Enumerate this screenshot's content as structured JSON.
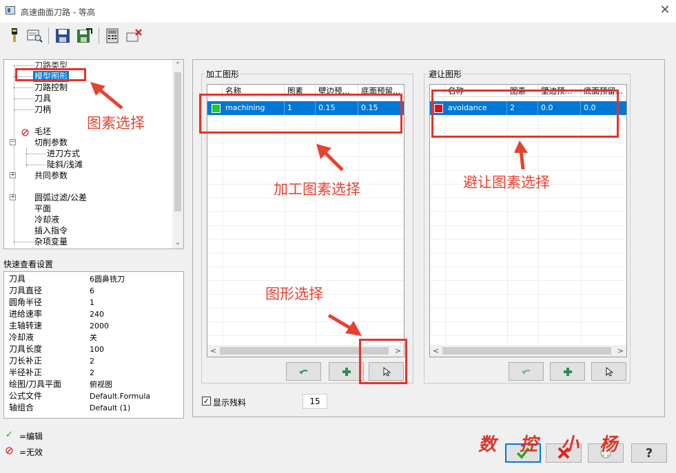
{
  "window": {
    "title": "高速曲面刀路 - 等高",
    "close": "✕"
  },
  "toolbar": {
    "icons": [
      "tool-icon",
      "preview-icon",
      "save-icon",
      "save-as-icon",
      "calculator-icon",
      "delete-icon"
    ]
  },
  "tree": {
    "items": [
      {
        "label": "刀路类型"
      },
      {
        "label": "模型图形",
        "selected": true
      },
      {
        "label": "刀路控制"
      },
      {
        "label": "刀具"
      },
      {
        "label": "刀柄"
      },
      {
        "label": ""
      },
      {
        "label": "毛坯"
      },
      {
        "label": "切削参数"
      },
      {
        "label": "进刀方式"
      },
      {
        "label": "陡斜/浅滩"
      },
      {
        "label": "共同参数"
      },
      {
        "label": ""
      },
      {
        "label": "圆弧过滤/公差"
      },
      {
        "label": "平面"
      },
      {
        "label": "冷却液"
      },
      {
        "label": "插入指令"
      },
      {
        "label": "杂项变量"
      }
    ]
  },
  "quick_view": {
    "label": "快速查看设置",
    "rows": [
      {
        "k": "刀具",
        "v": "6圆鼻铣刀"
      },
      {
        "k": "刀具直径",
        "v": "6"
      },
      {
        "k": "圆角半径",
        "v": "1"
      },
      {
        "k": "进给速率",
        "v": "240"
      },
      {
        "k": "主轴转速",
        "v": "2000"
      },
      {
        "k": "冷却液",
        "v": "关"
      },
      {
        "k": "刀具长度",
        "v": "100"
      },
      {
        "k": "刀长补正",
        "v": "2"
      },
      {
        "k": "半径补正",
        "v": "2"
      },
      {
        "k": "绘图/刀具平面",
        "v": "俯视图"
      },
      {
        "k": "公式文件",
        "v": "Default.Formula"
      },
      {
        "k": "轴组合",
        "v": "Default (1)"
      }
    ]
  },
  "legend": {
    "edit": "=编辑",
    "invalid": "=无效"
  },
  "machining": {
    "title": "加工图形",
    "headers": [
      "名称",
      "图素",
      "壁边预...",
      "底面预留..."
    ],
    "row": {
      "name": "machining",
      "count": "1",
      "wall": "0.15",
      "floor": "0.15",
      "color": "#22cc22"
    }
  },
  "avoidance": {
    "title": "避让图形",
    "headers": [
      "名称",
      "图素",
      "壁边预...",
      "底面预留..."
    ],
    "row": {
      "name": "avoidance",
      "count": "2",
      "wall": "0.0",
      "floor": "0.0",
      "color": "#e01010"
    }
  },
  "show_remaining": {
    "label": "显示残料",
    "checked": true,
    "value": "15"
  },
  "annotations": {
    "entity_select": "图素选择",
    "machining_select": "加工图素选择",
    "avoid_select": "避让图素选择",
    "shape_select": "图形选择"
  },
  "signature": [
    "数",
    "控",
    "小",
    "杨"
  ],
  "colors": {
    "accent": "#0078d7",
    "annotation": "#e8312a"
  }
}
